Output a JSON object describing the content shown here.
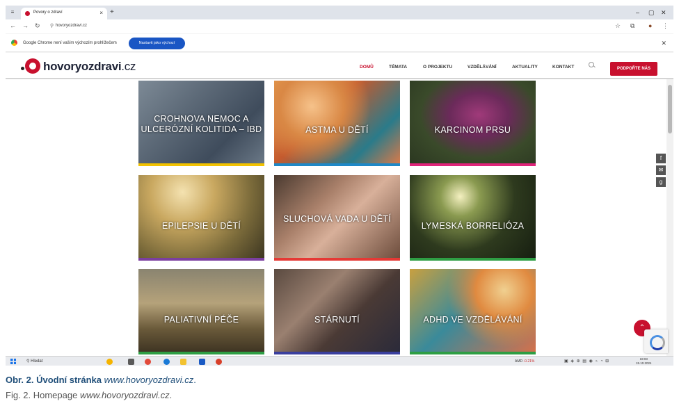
{
  "browser": {
    "tab_title": "Povory o zdraví",
    "tab_close": "×",
    "new_tab": "+",
    "menu": "≡",
    "window_controls": [
      "–",
      "▢",
      "✕"
    ],
    "nav_icons": [
      "←",
      "→",
      "↻"
    ],
    "url": "hovoryozdravi.cz",
    "toolbar_icons": [
      "☆",
      "⧉",
      "●",
      "⋮"
    ],
    "infobar_text": "Google Chrome není vaším výchozím prohlížečem",
    "infobar_button": "Nastavit jako výchozí",
    "infobar_close": "✕"
  },
  "site": {
    "logo_main": "hovoryozdravi",
    "logo_tld": ".cz",
    "nav": [
      "DOMŮ",
      "TÉMATA",
      "O PROJEKTU",
      "VZDĚLÁVÁNÍ",
      "AKTUALITY",
      "KONTAKT"
    ],
    "active_nav": "DOMŮ",
    "support_button": "PODPOŘTE NÁS",
    "brand_color": "#c8102e",
    "social_icons": [
      "f",
      "✉",
      "g"
    ],
    "back_to_top": "⌃"
  },
  "cards": [
    {
      "label": "CROHNOVA NEMOC A ULCERÓZNÍ KOLITIDA – IBD",
      "bar_color": "#f2c200"
    },
    {
      "label": "ASTMA U DĚTÍ",
      "bar_color": "#1e88c7"
    },
    {
      "label": "KARCINOM PRSU",
      "bar_color": "#e0247a"
    },
    {
      "label": "EPILEPSIE U DĚTÍ",
      "bar_color": "#7b3fa0"
    },
    {
      "label": "SLUCHOVÁ VADA U DĚTÍ",
      "bar_color": "#e53935"
    },
    {
      "label": "LYMESKÁ BORRELIÓZA",
      "bar_color": "#2e9e44"
    },
    {
      "label": "PALIATIVNÍ PÉČE",
      "bar_color": "#2e9e44"
    },
    {
      "label": "STÁRNUTÍ",
      "bar_color": "#3a3f9e"
    },
    {
      "label": "ADHD VE VZDĚLÁVÁNÍ",
      "bar_color": "#2e9e44"
    }
  ],
  "taskbar": {
    "search": "Hledat",
    "stock_name": "AMD",
    "stock_change": "-0.21%",
    "time": "19:03",
    "date": "15.10.2024"
  },
  "caption": {
    "cz_prefix": "Obr. 2. Úvodní stránka",
    "cz_url": "www.hovoryozdravi.cz",
    "cz_suffix": ".",
    "en_prefix": "Fig. 2. Homepage",
    "en_url": "www.hovoryozdravi.cz",
    "en_suffix": "."
  }
}
